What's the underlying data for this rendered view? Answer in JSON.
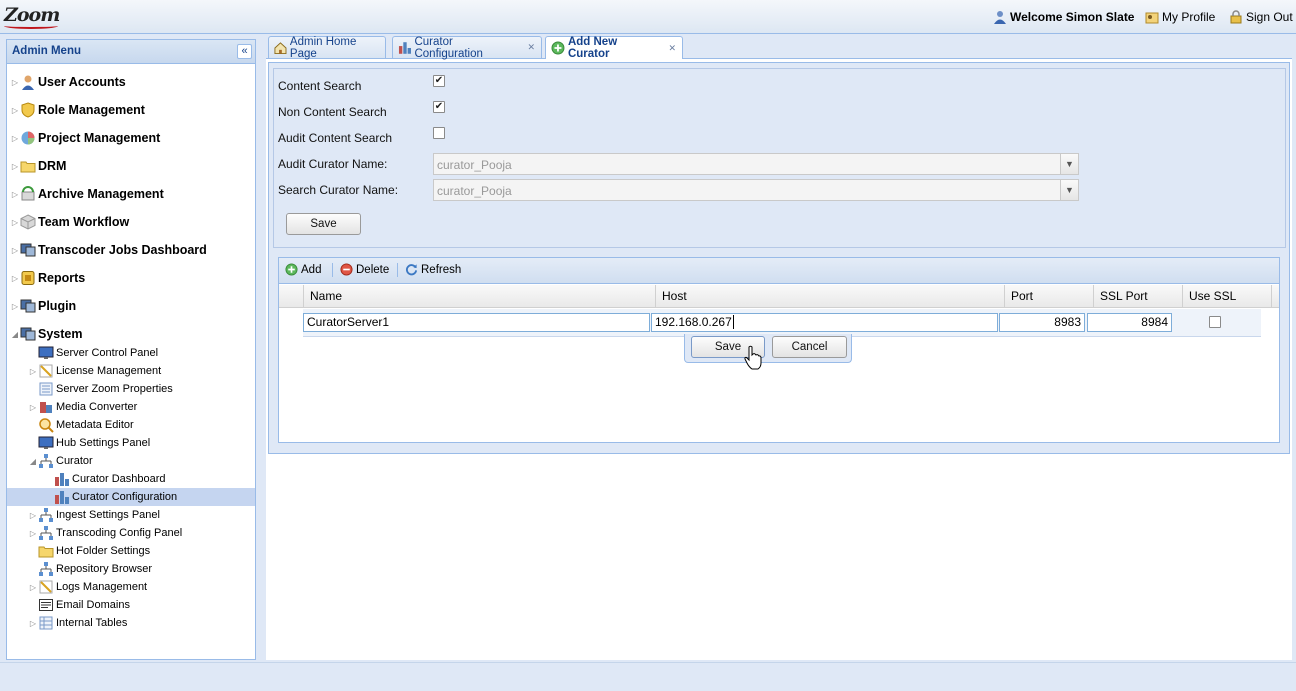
{
  "header": {
    "logo_text": "Zoom",
    "welcome_text": "Welcome Simon Slate",
    "my_profile_label": "My Profile",
    "sign_out_label": "Sign Out"
  },
  "sidebar": {
    "title": "Admin Menu",
    "collapse_glyph": "«",
    "items": [
      {
        "label": "User Accounts",
        "icon": "user-icon"
      },
      {
        "label": "Role Management",
        "icon": "shield-icon"
      },
      {
        "label": "Project Management",
        "icon": "globe-chart-icon"
      },
      {
        "label": "DRM",
        "icon": "folder-icon"
      },
      {
        "label": "Archive Management",
        "icon": "archive-icon"
      },
      {
        "label": "Team Workflow",
        "icon": "cube-icon"
      },
      {
        "label": "Transcoder Jobs Dashboard",
        "icon": "monitor-icon"
      },
      {
        "label": "Reports",
        "icon": "report-icon"
      },
      {
        "label": "Plugin",
        "icon": "monitor-icon"
      },
      {
        "label": "System",
        "icon": "monitor-icon"
      }
    ],
    "system_children": [
      {
        "label": "Server Control Panel",
        "icon": "screen-icon"
      },
      {
        "label": "License Management",
        "icon": "license-icon"
      },
      {
        "label": "Server Zoom Properties",
        "icon": "properties-icon"
      },
      {
        "label": "Media Converter",
        "icon": "media-converter-icon"
      },
      {
        "label": "Metadata Editor",
        "icon": "metadata-icon"
      },
      {
        "label": "Hub Settings Panel",
        "icon": "screen-icon"
      },
      {
        "label": "Curator",
        "icon": "network-icon"
      },
      {
        "label": "Curator Dashboard",
        "icon": "bar-chart-icon"
      },
      {
        "label": "Curator Configuration",
        "icon": "bar-chart-icon"
      },
      {
        "label": "Ingest Settings Panel",
        "icon": "network-icon"
      },
      {
        "label": "Transcoding Config Panel",
        "icon": "network-icon"
      },
      {
        "label": "Hot Folder Settings",
        "icon": "folder-icon"
      },
      {
        "label": "Repository Browser",
        "icon": "network-icon"
      },
      {
        "label": "Logs Management",
        "icon": "license-icon"
      },
      {
        "label": "Email Domains",
        "icon": "list-icon"
      },
      {
        "label": "Internal Tables",
        "icon": "table-icon"
      }
    ]
  },
  "tabs": [
    {
      "label": "Admin Home Page",
      "icon": "home-icon"
    },
    {
      "label": "Curator Configuration",
      "icon": "bar-chart-icon"
    },
    {
      "label": "Add New Curator",
      "icon": "add-icon"
    }
  ],
  "form": {
    "content_search_label": "Content Search",
    "content_search_checked": true,
    "non_content_search_label": "Non Content Search",
    "non_content_search_checked": true,
    "audit_content_search_label": "Audit Content Search",
    "audit_content_search_checked": false,
    "audit_curator_name_label": "Audit Curator Name:",
    "audit_curator_name_value": "curator_Pooja",
    "search_curator_name_label": "Search Curator Name:",
    "search_curator_name_value": "curator_Pooja",
    "save_label": "Save",
    "checkmark": "✔"
  },
  "grid": {
    "toolbar": {
      "add_label": "Add",
      "delete_label": "Delete",
      "refresh_label": "Refresh"
    },
    "columns": [
      "Name",
      "Host",
      "Port",
      "SSL Port",
      "Use SSL"
    ],
    "edit_row": {
      "name": "CuratorServer1",
      "host": "192.168.0.267",
      "port": "8983",
      "ssl_port": "8984",
      "use_ssl": false
    },
    "row_editor": {
      "save_label": "Save",
      "cancel_label": "Cancel"
    }
  },
  "colors": {
    "accent": "#15428b",
    "border": "#99bbe8",
    "panel_bg": "#dfe8f6",
    "selected": "#c5d5f0"
  }
}
